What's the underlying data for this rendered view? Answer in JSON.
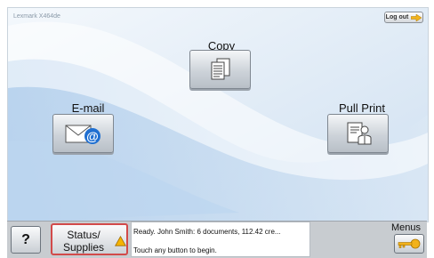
{
  "header": {
    "model": "Lexmark X464de",
    "logout_label": "Log out"
  },
  "tiles": {
    "copy": {
      "label": "Copy",
      "icon": "copy-document-icon"
    },
    "email": {
      "label": "E-mail",
      "icon": "email-envelope-icon"
    },
    "pull_print": {
      "label": "Pull Print",
      "icon": "pull-print-person-icon"
    }
  },
  "bottom": {
    "help_label": "?",
    "status_label_1": "Status/",
    "status_label_2": "Supplies",
    "status_icon": "warning-triangle-icon",
    "message_line1": "Ready. John Smith: 6 documents, 112.42 cre...",
    "message_line2": "Touch any button to begin.",
    "menus_label": "Menus",
    "menus_icon": "key-icon"
  },
  "colors": {
    "background": "#dfeaf5",
    "status_border": "#d24a4a",
    "warning": "#f5b400",
    "email_accent": "#1f6fd1",
    "key": "#f2b21b"
  }
}
